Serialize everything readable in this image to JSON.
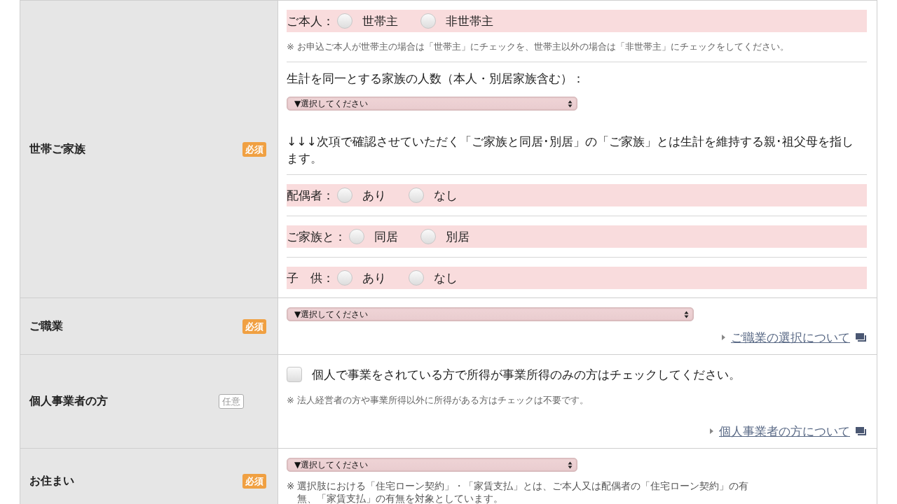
{
  "rows": [
    {
      "label": "世帯ご家族",
      "badge": {
        "kind": "required",
        "text": "必須"
      },
      "content": [
        {
          "kind": "radio",
          "label": "ご本人：",
          "options": [
            {
              "label": "世帯主",
              "selected": false
            },
            {
              "label": "非世帯主",
              "selected": false
            }
          ]
        },
        {
          "kind": "note",
          "text": "※ お申込ご本人が世帯主の場合は「世帯主」にチェックを、世帯主以外の場合は「非世帯主」にチェックをしてください。"
        },
        {
          "kind": "divider"
        },
        {
          "kind": "label",
          "text": "生計を同一とする家族の人数（本人・別居家族含む）："
        },
        {
          "kind": "select",
          "value": "▼選択してください"
        },
        {
          "kind": "info",
          "text": "↓↓↓次項で確認させていただく「ご家族と同居･別居」の「ご家族」とは生計を維持する親･祖父母を指します。"
        },
        {
          "kind": "divider"
        },
        {
          "kind": "radio",
          "label": "配偶者：",
          "options": [
            {
              "label": "あり",
              "selected": false
            },
            {
              "label": "なし",
              "selected": false
            }
          ]
        },
        {
          "kind": "divider"
        },
        {
          "kind": "radio",
          "label": "ご家族と：",
          "options": [
            {
              "label": "同居",
              "selected": false
            },
            {
              "label": "別居",
              "selected": false
            }
          ]
        },
        {
          "kind": "divider"
        },
        {
          "kind": "radio",
          "label": "子　供：",
          "options": [
            {
              "label": "あり",
              "selected": false
            },
            {
              "label": "なし",
              "selected": false
            }
          ]
        }
      ]
    },
    {
      "label": "ご職業",
      "badge": {
        "kind": "required",
        "text": "必須"
      },
      "content": [
        {
          "kind": "select",
          "value": "▼選択してください",
          "wide": true
        },
        {
          "kind": "link",
          "text": "ご職業の選択について"
        }
      ]
    },
    {
      "label": "個人事業者の方",
      "badge": {
        "kind": "optional",
        "text": "任意"
      },
      "content": [
        {
          "kind": "check",
          "text": "個人で事業をされている方で所得が事業所得のみの方はチェックしてください。",
          "checked": false
        },
        {
          "kind": "note",
          "text": "※ 法人経営者の方や事業所得以外に所得がある方はチェックは不要です。"
        },
        {
          "kind": "link",
          "text": "個人事業者の方について"
        }
      ]
    },
    {
      "label": "お住まい",
      "badge": {
        "kind": "required",
        "text": "必須"
      },
      "content": [
        {
          "kind": "select",
          "value": "▼選択してください"
        },
        {
          "kind": "hanging-note",
          "mark": "※",
          "text": "選択肢における「住宅ローン契約」・「家賃支払」とは、ご本人又は配偶者の「住宅ローン契約」の有無、「家賃支払」の有無を対象としています。"
        }
      ]
    }
  ]
}
